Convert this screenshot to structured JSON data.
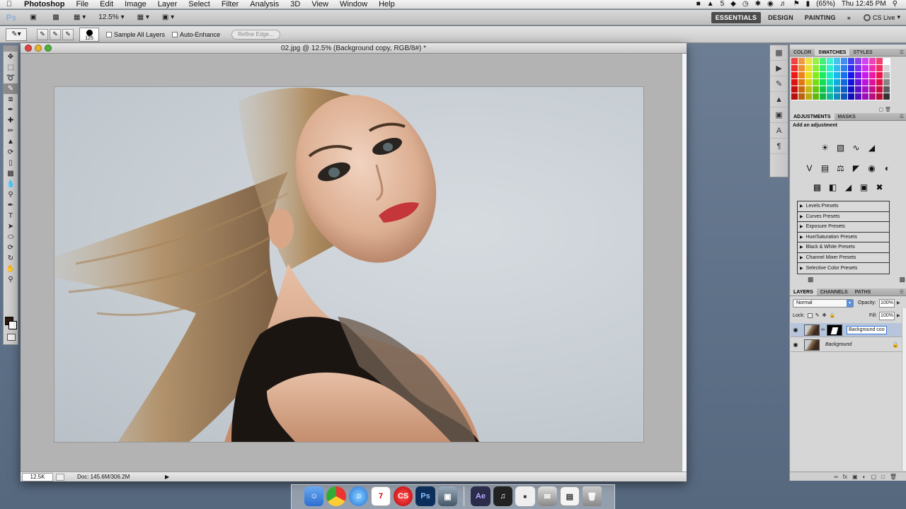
{
  "menubar": {
    "apple_icon": "apple-icon",
    "app_name": "Photoshop",
    "menus": [
      "File",
      "Edit",
      "Image",
      "Layer",
      "Select",
      "Filter",
      "Analysis",
      "3D",
      "View",
      "Window",
      "Help"
    ],
    "tray": {
      "battery_text": "(65%)",
      "clock": "Thu 12:45 PM",
      "adobe_count": "5"
    }
  },
  "appbar": {
    "zoom": "12.5%",
    "workspaces": [
      "ESSENTIALS",
      "DESIGN",
      "PAINTING"
    ],
    "active_workspace": "ESSENTIALS",
    "more": "»",
    "cs_live": "CS Live"
  },
  "options": {
    "brush_size": "125",
    "sample_all_layers": "Sample All Layers",
    "auto_enhance": "Auto-Enhance",
    "refine_edge": "Refine Edge..."
  },
  "document": {
    "title": "02.jpg @ 12.5% (Background copy, RGB/8#) *",
    "status_zoom": "12.5K",
    "doc_info": "Doc: 145.6M/306.2M"
  },
  "panels": {
    "color_tabs": [
      "COLOR",
      "SWATCHES",
      "STYLES"
    ],
    "color_active": "SWATCHES",
    "adjust_tabs": [
      "ADJUSTMENTS",
      "MASKS"
    ],
    "adjust_active": "ADJUSTMENTS",
    "adjust_title": "Add an adjustment",
    "presets": [
      "Levels Presets",
      "Curves Presets",
      "Exposure Presets",
      "Hue/Saturation Presets",
      "Black & White Presets",
      "Channel Mixer Presets",
      "Selective Color Presets"
    ],
    "layer_tabs": [
      "LAYERS",
      "CHANNELS",
      "PATHS"
    ],
    "layers_active": "LAYERS",
    "blend_mode": "Normal",
    "opacity_label": "Opacity:",
    "opacity": "100%",
    "lock_label": "Lock:",
    "fill_label": "Fill:",
    "fill": "100%",
    "layers": [
      {
        "name": "Background coo",
        "selected": true,
        "editing": true
      },
      {
        "name": "Background",
        "selected": false,
        "locked": true
      }
    ]
  },
  "dock_apps": [
    "Finder",
    "Chrome",
    "iTunes",
    "Calendar",
    "Adobe CS",
    "Photoshop",
    "Photo",
    "Ae",
    "Logic",
    "Prefs",
    "Mail",
    "Chart",
    "Trash"
  ],
  "colors": {
    "accent": "#3a7bd5",
    "layer_selected": "#b6c5dc",
    "desktop": "#5f7188"
  }
}
